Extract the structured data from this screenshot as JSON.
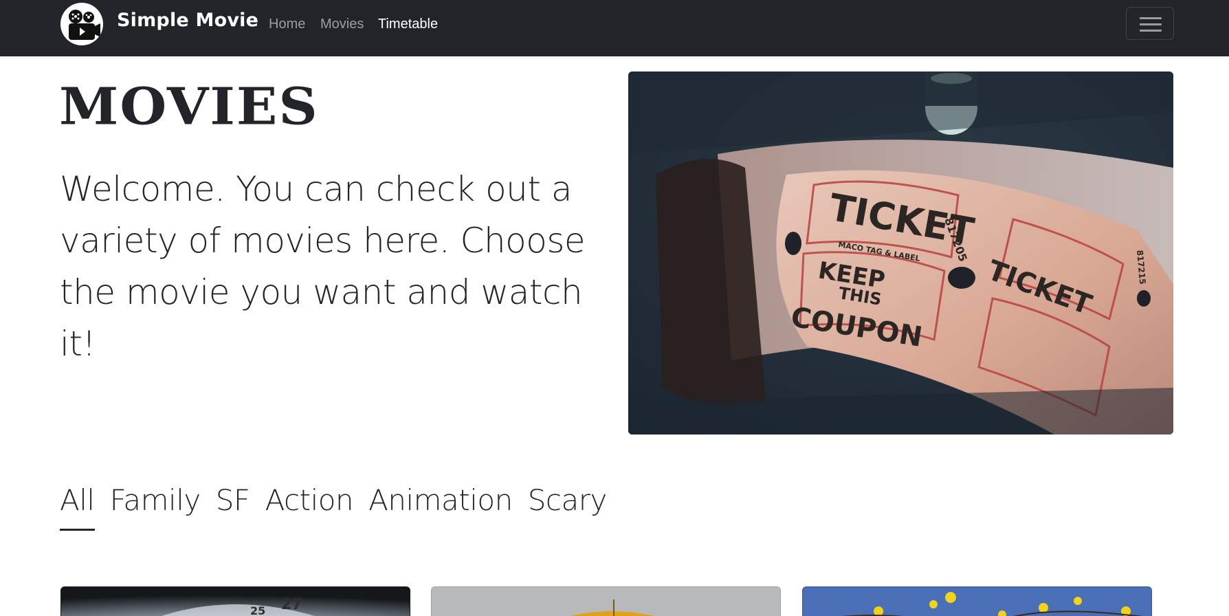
{
  "navbar": {
    "brand": "Simple Movie",
    "links": [
      {
        "label": "Home",
        "active": false
      },
      {
        "label": "Movies",
        "active": false
      },
      {
        "label": "Timetable",
        "active": true
      }
    ],
    "menu_icon": "hamburger-icon",
    "logo_icon": "film-camera-logo-icon"
  },
  "hero": {
    "title": "MOVIES",
    "text": "Welcome. You can check out a variety of movies here. Choose the movie you want and watch it!",
    "image": {
      "tickets": [
        {
          "label": "TICKET",
          "subtitle": "MACO TAG & LABEL",
          "serial": "817205",
          "coupon": [
            "KEEP",
            "THIS",
            "COUPON"
          ]
        },
        {
          "label": "TICKET",
          "serial": "817215"
        }
      ]
    }
  },
  "filters": {
    "items": [
      "All",
      "Family",
      "SF",
      "Action",
      "Animation",
      "Scary"
    ],
    "active": "All"
  },
  "cards": [
    {
      "clock_numbers": [
        "25",
        "27"
      ]
    },
    {},
    {}
  ],
  "colors": {
    "navbar_bg": "#212529",
    "nav_active": "#ffffff",
    "nav_inactive": "rgba(255,255,255,0.55)",
    "text": "#212529"
  }
}
